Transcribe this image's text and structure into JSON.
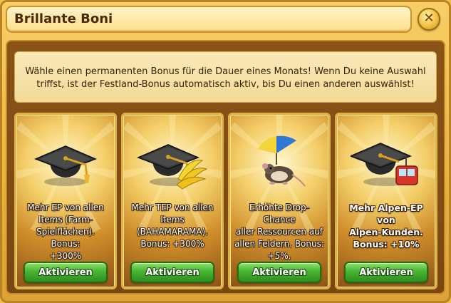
{
  "dialog": {
    "title": "Brillante Boni",
    "close_label": "✕",
    "intro_line1": "Wähle einen permanenten Bonus für die Dauer eines Monats! Wenn Du keine Auswahl",
    "intro_line2": "triffst, ist der Festland-Bonus automatisch aktiv, bis Du einen anderen auswählst!"
  },
  "cards": [
    {
      "icon": "graduation-cap-icon",
      "lines": [
        "Mehr EP von allen",
        "Items (Farm-",
        "Spielflächen). Bonus:",
        "+300%"
      ],
      "button": "Aktivieren"
    },
    {
      "icon": "graduation-cap-bananas-icon",
      "lines": [
        "Mehr TEP von allen",
        "Items",
        "(BAHAMARAMA).",
        "Bonus: +300%"
      ],
      "button": "Aktivieren"
    },
    {
      "icon": "mouse-umbrella-icon",
      "lines": [
        "Erhöhte Drop-Chance",
        "aller Ressourcen auf",
        "allen Feldern. Bonus:",
        "+5%."
      ],
      "button": "Aktivieren"
    },
    {
      "icon": "graduation-cap-gondola-icon",
      "lines": [
        "Mehr Alpen-EP von",
        "Alpen-Kunden.",
        "Bonus: +10%"
      ],
      "button": "Aktivieren"
    }
  ],
  "colors": {
    "frame": "#eab33c",
    "panel": "#7a4711",
    "button_green": "#47b532",
    "text_dark": "#3a2107"
  }
}
